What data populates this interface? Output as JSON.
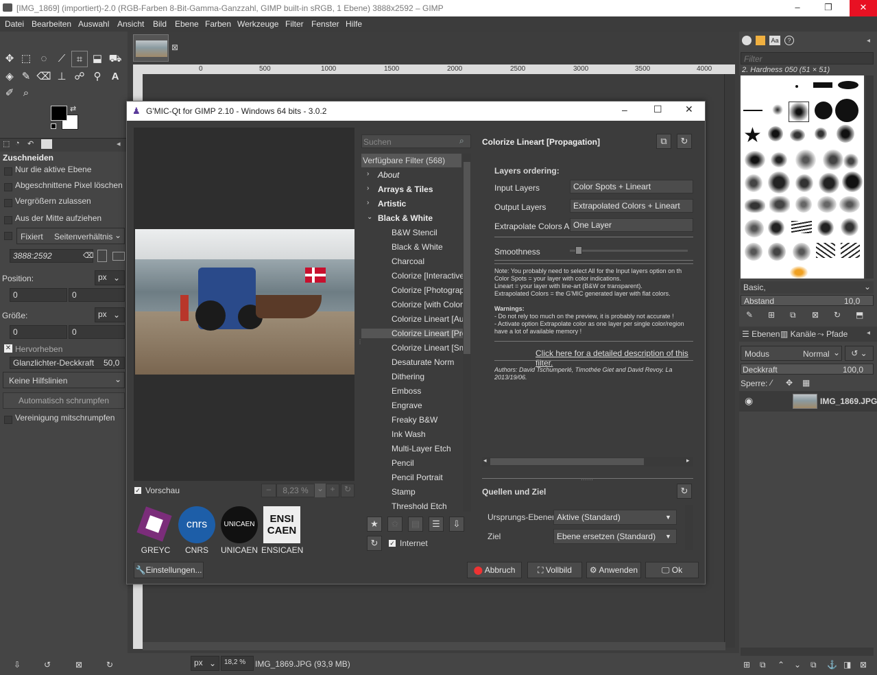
{
  "window": {
    "title": "[IMG_1869] (importiert)-2.0 (RGB-Farben 8-Bit-Gamma-Ganzzahl, GIMP built-in sRGB, 1 Ebene) 3888x2592 – GIMP"
  },
  "menu": [
    "Datei",
    "Bearbeiten",
    "Auswahl",
    "Ansicht",
    "Bild",
    "Ebene",
    "Farben",
    "Werkzeuge",
    "Filter",
    "Fenster",
    "Hilfe"
  ],
  "tool_options": {
    "title": "Zuschneiden",
    "only_active_layer": "Nur die aktive Ebene",
    "delete_cropped": "Abgeschnittene Pixel löschen",
    "allow_growing": "Vergrößern zulassen",
    "from_center": "Aus der Mitte aufziehen",
    "fixed_label": "Fixiert",
    "fixed_value": "Seitenverhältnis",
    "ratio_value": "3888:2592",
    "position_label": "Position:",
    "position_unit": "px",
    "position_x": "0",
    "position_y": "0",
    "size_label": "Größe:",
    "size_unit": "px",
    "size_w": "0",
    "size_h": "0",
    "highlight_label": "Hervorheben",
    "highlight_opacity_label": "Glanzlichter-Deckkraft",
    "highlight_opacity_value": "50,0",
    "guides": "Keine Hilfslinien",
    "auto_shrink": "Automatisch schrumpfen",
    "shrink_merged": "Vereinigung mitschrumpfen"
  },
  "ruler_ticks": [
    "0",
    "500",
    "1000",
    "1500",
    "2000",
    "2500",
    "3000",
    "3500",
    "4000"
  ],
  "statusbar": {
    "unit": "px",
    "zoom": "18,2 %",
    "file": "IMG_1869.JPG (93,9 MB)"
  },
  "dialog": {
    "title": "G'MIC-Qt for GIMP 2.10 - Windows 64 bits - 3.0.2",
    "search_placeholder": "Suchen",
    "filters_header": "Verfügbare Filter (568)",
    "categories": [
      {
        "label": "About",
        "italic": true
      },
      {
        "label": "Arrays & Tiles"
      },
      {
        "label": "Artistic"
      },
      {
        "label": "Black & White"
      }
    ],
    "filters": [
      "B&W Stencil",
      "Black & White",
      "Charcoal",
      "Colorize [Interactive]",
      "Colorize [Photographs]",
      "Colorize [with Colormap]",
      "Colorize Lineart [Auto-Fill]",
      "Colorize Lineart [Propagation]",
      "Colorize Lineart [Smart Coloring]",
      "Desaturate Norm",
      "Dithering",
      "Emboss",
      "Engrave",
      "Freaky B&W",
      "Ink Wash",
      "Multi-Layer Etch",
      "Pencil",
      "Pencil Portrait",
      "Stamp",
      "Threshold Etch"
    ],
    "selected_filter_index": 7,
    "preview_label": "Vorschau",
    "zoom_value": "8,23 %",
    "logos": [
      {
        "label": "GREYC",
        "color": "#7b2d7a"
      },
      {
        "label": "CNRS",
        "color": "#1d5ea8"
      },
      {
        "label": "UNICAEN",
        "color": "#111111"
      },
      {
        "label": "ENSICAEN",
        "color": "#eeeeee"
      }
    ],
    "internet_label": "Internet",
    "settings_button": "Einstellungen...",
    "filter_title": "Colorize Lineart [Propagation]",
    "layers_ordering": "Layers ordering:",
    "params": [
      {
        "label": "Input Layers",
        "value": "Color Spots + Lineart"
      },
      {
        "label": "Output Layers",
        "value": "Extrapolated Colors + Lineart"
      },
      {
        "label": "Extrapolate Colors As",
        "value": "One Layer"
      }
    ],
    "smoothness_label": "Smoothness",
    "smoothness_value": 0.05,
    "note_lines": [
      "Note: You probably need to select All for the Input layers option on th",
      "Color Spots = your layer with color indications.",
      "Lineart = your layer with line-art (B&W or transparent).",
      "Extrapolated Colors = the G'MIC generated layer with flat colors."
    ],
    "warnings_title": "Warnings:",
    "warning_lines": [
      "- Do not rely too much on the preview, it is probably not accurate !",
      "- Activate option Extrapolate color as one layer per single color/region",
      "have a lot of available memory !"
    ],
    "description_link": "Click here for a detailed description of this filter.",
    "authors_line1": "Authors: David Tschumperlé, Timothée Giet and David Revoy.   La",
    "authors_line2": "2013/19/06.",
    "io_title": "Quellen und Ziel",
    "source_label": "Ursprungs-Ebenen",
    "source_value": "Aktive (Standard)",
    "target_label": "Ziel",
    "target_value": "Ebene ersetzen (Standard)",
    "buttons": {
      "cancel": "Abbruch",
      "fullscreen": "Vollbild",
      "apply": "Anwenden",
      "ok": "Ok"
    }
  },
  "brushes": {
    "filter_placeholder": "Filter",
    "current": "2. Hardness 050 (51 × 51)",
    "preset": "Basic,",
    "spacing_label": "Abstand",
    "spacing_value": "10,0"
  },
  "layers": {
    "tabs": [
      "Ebenen",
      "Kanäle",
      "Pfade"
    ],
    "mode_label": "Modus",
    "mode_value": "Normal",
    "opacity_label": "Deckkraft",
    "opacity_value": "100,0",
    "lock_label": "Sperre:",
    "layer_name": "IMG_1869.JPG"
  },
  "accent": "#4a90d9"
}
